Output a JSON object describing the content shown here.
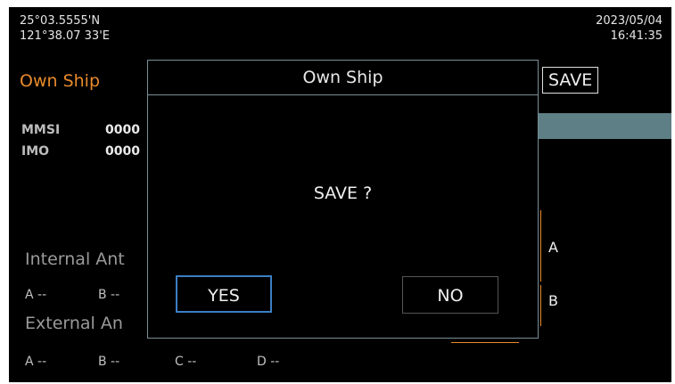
{
  "status": {
    "lat": "25°03.5555'N",
    "lon": "121°38.07 33'E",
    "date": "2023/05/04",
    "time": "16:41:35"
  },
  "header": {
    "title": "Own Ship",
    "save_label": "SAVE"
  },
  "fields": {
    "mmsi_label": "MMSI",
    "mmsi_value": "0000",
    "imo_label": "IMO",
    "imo_value": "0000"
  },
  "antenna": {
    "internal_title": "Internal Ant",
    "internal_a": "A --",
    "internal_b": "B --",
    "external_title": "External An",
    "external_a": "A --",
    "external_b": "B --",
    "external_c": "C --",
    "external_d": "D --",
    "diagram_a": "A",
    "diagram_b": "B"
  },
  "dialog": {
    "title": "Own Ship",
    "message": "SAVE ?",
    "yes_label": "YES",
    "no_label": "NO"
  },
  "colors": {
    "accent": "#e88a2a",
    "focus": "#3c7fc4",
    "bar": "#5e7f86"
  }
}
